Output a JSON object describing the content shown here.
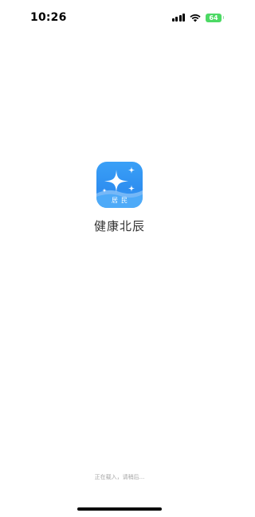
{
  "status_bar": {
    "time": "10:26",
    "battery_level": "64",
    "icons": [
      "signal-icon",
      "wifi-icon",
      "battery-icon"
    ]
  },
  "app": {
    "name": "健康北辰",
    "icon_badge": "居民",
    "icon_name": "sparkle-app-icon"
  },
  "loading": {
    "text": "正在载入，请稍后..."
  },
  "colors": {
    "icon_blue": "#2e8ef0",
    "battery_green": "#4cd964",
    "name_text": "#333333",
    "loading_text": "#a6a6a6"
  }
}
